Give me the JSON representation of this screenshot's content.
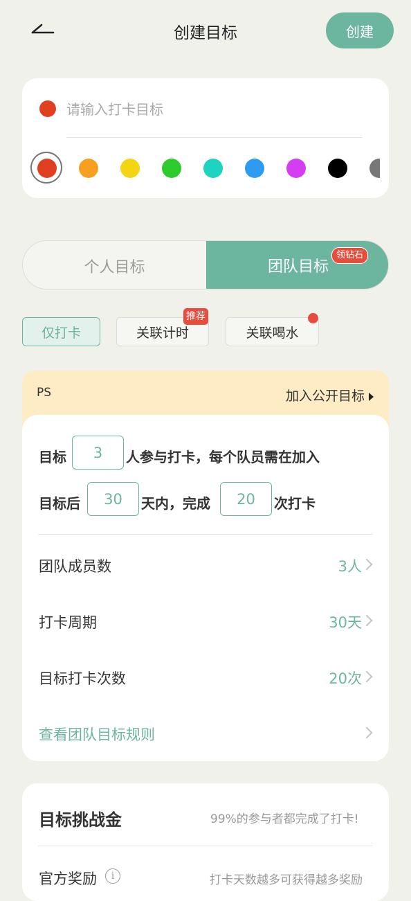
{
  "header": {
    "title": "创建目标",
    "create_label": "创建"
  },
  "goal": {
    "placeholder": "请输入打卡目标",
    "current_color": "#e0401f",
    "colors": [
      "#e0401f",
      "#f5a11f",
      "#f3d513",
      "#2bcc2b",
      "#1fd3c1",
      "#2d9cf0",
      "#d43df2",
      "#000000",
      "#777777"
    ],
    "selected_index": 0
  },
  "segment": {
    "personal": "个人目标",
    "team": "团队目标",
    "team_badge": "领钻石",
    "active": "team"
  },
  "chips": {
    "checkin_only": "仅打卡",
    "link_timer": "关联计时",
    "timer_tag": "推荐",
    "link_water": "关联喝水"
  },
  "banner": {
    "ps": "PS",
    "public_link": "加入公开目标"
  },
  "team": {
    "sentence": {
      "p1": "目标",
      "members": "3",
      "p2": "人参与打卡，每个队员需在加入",
      "p3": "目标后",
      "days": "30",
      "p4": "天内，完成",
      "times": "20",
      "p5": "次打卡"
    },
    "rows": [
      {
        "label": "团队成员数",
        "value": "3人"
      },
      {
        "label": "打卡周期",
        "value": "30天"
      },
      {
        "label": "目标打卡次数",
        "value": "20次"
      }
    ],
    "rules_link": "查看团队目标规则"
  },
  "challenge": {
    "title": "目标挑战金",
    "note": "99%的参与者都完成了打卡!",
    "reward_label": "官方奖励",
    "reward_note": "打卡天数越多可获得越多奖励"
  }
}
